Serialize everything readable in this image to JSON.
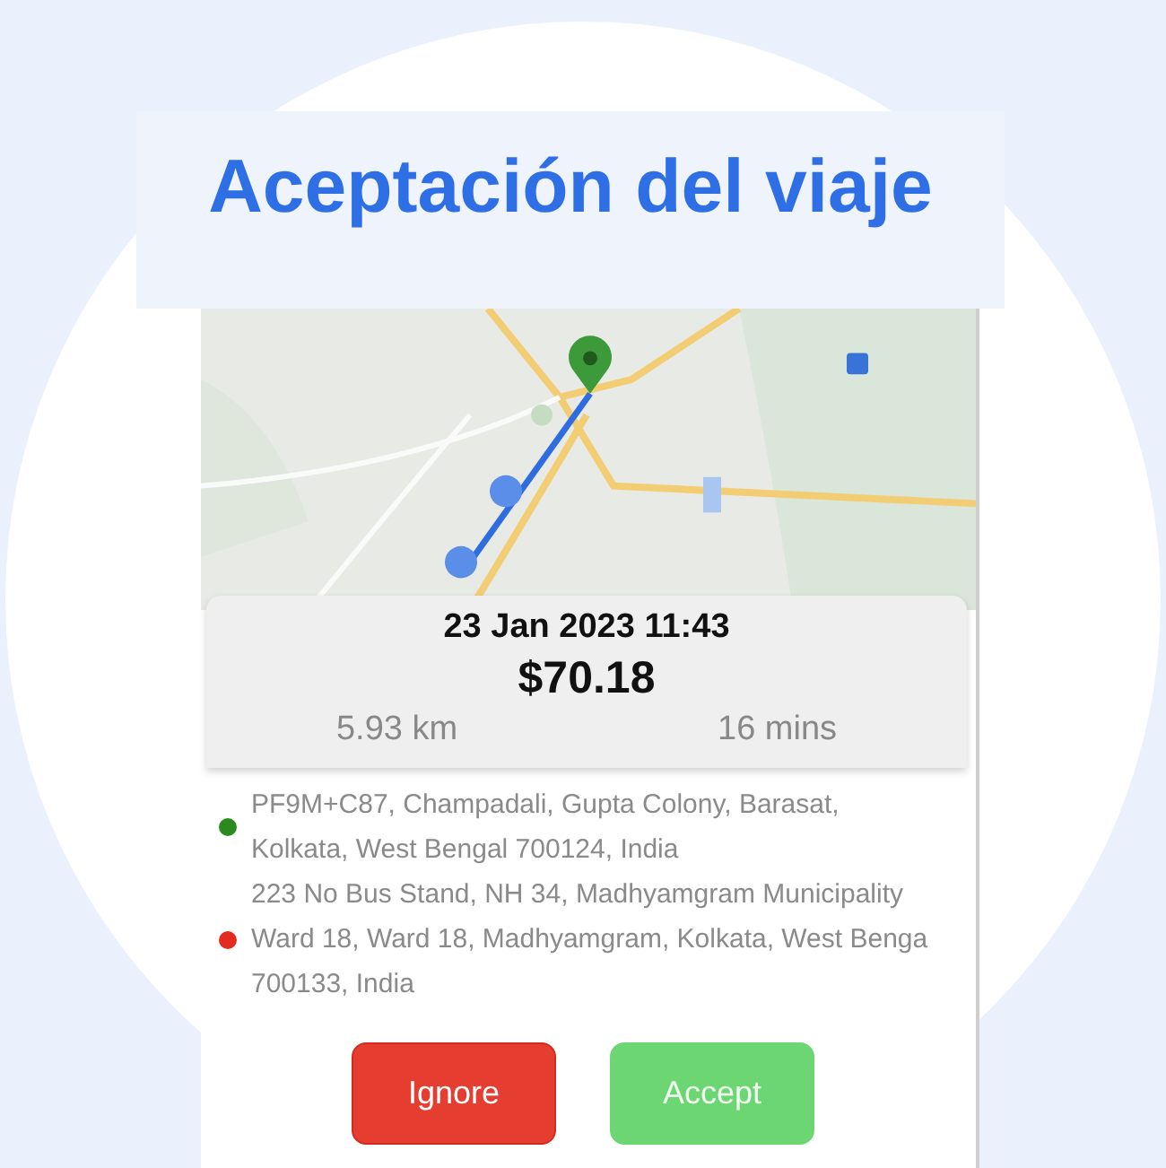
{
  "title": "Aceptación del viaje",
  "trip": {
    "datetime": "23 Jan 2023 11:43",
    "price": "$70.18",
    "distance": "5.93 km",
    "duration": "16 mins"
  },
  "addresses": [
    {
      "lines": [
        "PF9M+C87, Champadali, Gupta Colony, Barasat,",
        "Kolkata, West Bengal 700124, India"
      ],
      "color": "#2a8a1e"
    },
    {
      "lines": [
        "223 No Bus Stand, NH 34, Madhyamgram Municipality",
        "Ward 18, Ward 18, Madhyamgram, Kolkata, West Benga",
        "700133, India"
      ],
      "color": "#e32b22"
    }
  ],
  "buttons": [
    {
      "label": "Ignore",
      "kind": "reject"
    },
    {
      "label": "Accept",
      "kind": "accept"
    }
  ]
}
